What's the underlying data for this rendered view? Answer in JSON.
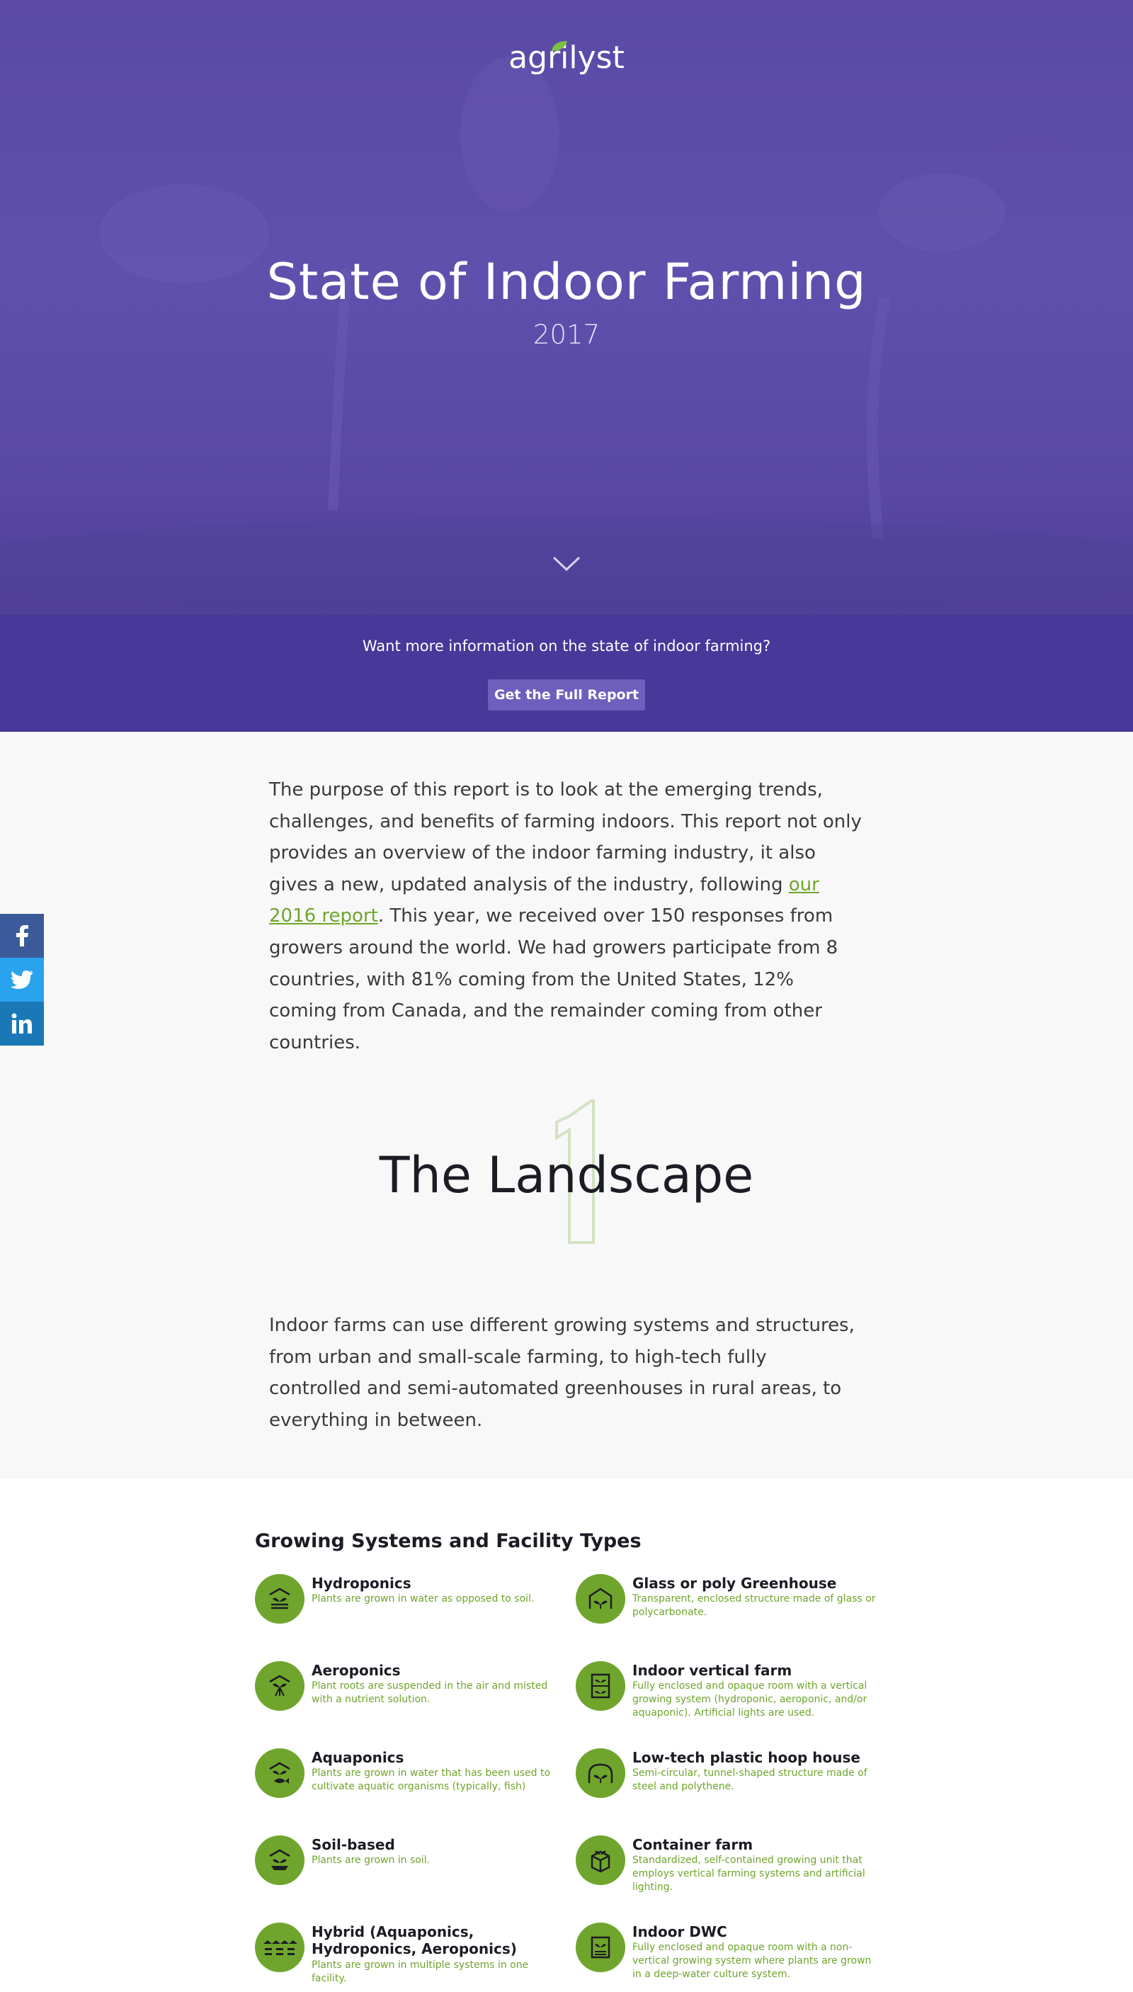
{
  "hero": {
    "logo": "agrilyst",
    "title": "State of Indoor Farming",
    "year": "2017"
  },
  "cta": {
    "text": "Want more information on the state of indoor farming?",
    "button": "Get the Full Report"
  },
  "social": [
    "facebook-icon",
    "twitter-icon",
    "linkedin-icon"
  ],
  "intro": {
    "before_link": "The purpose of this report is to look at the emerging trends, challenges, and benefits of farming indoors. This report not only provides an overview of the indoor farming industry, it also gives a new, updated analysis of the industry, following ",
    "link": "our 2016 report",
    "after_link": ". This year, we received over 150 responses from growers around the world. We had growers participate from 8 countries, with 81% coming from the United States, 12% coming from Canada, and the remainder coming from other countries."
  },
  "landscape": {
    "number": "1",
    "title": "The Landscape",
    "text": "Indoor farms can use different growing systems and structures, from urban and small-scale farming, to high-tech fully controlled and semi-automated greenhouses in rural areas, to everything in between."
  },
  "systems": {
    "title": "Growing Systems and Facility Types",
    "left": [
      {
        "name": "Hydroponics",
        "desc": "Plants are grown in water as opposed to soil.",
        "icon": "hydroponics-icon"
      },
      {
        "name": "Aeroponics",
        "desc": "Plant roots are suspended in the air and misted with a nutrient solution.",
        "icon": "aeroponics-icon"
      },
      {
        "name": "Aquaponics",
        "desc": "Plants are grown in water that has been used to cultivate aquatic organisms (typically, fish)",
        "icon": "aquaponics-icon"
      },
      {
        "name": "Soil-based",
        "desc": "Plants are grown in soil.",
        "icon": "soil-icon"
      },
      {
        "name": "Hybrid (Aquaponics, Hydroponics, Aeroponics)",
        "desc": "Plants are grown in multiple systems in one facility.",
        "icon": "hybrid-icon"
      }
    ],
    "right": [
      {
        "name": "Glass or poly Greenhouse",
        "desc": "Transparent, enclosed structure made of glass or polycarbonate.",
        "icon": "greenhouse-icon"
      },
      {
        "name": "Indoor vertical farm",
        "desc": "Fully enclosed and opaque room with a vertical growing system (hydroponic, aeroponic, and/or aquaponic). Artificial lights are used.",
        "icon": "vertical-farm-icon"
      },
      {
        "name": "Low-tech plastic hoop house",
        "desc": "Semi-circular, tunnel-shaped structure made of steel and polythene.",
        "icon": "hoop-house-icon"
      },
      {
        "name": "Container farm",
        "desc": "Standardized, self-contained growing unit that employs vertical farming systems and artificial lighting.",
        "icon": "container-icon"
      },
      {
        "name": "Indoor DWC",
        "desc": "Fully enclosed and opaque room with a non-vertical growing system where plants are grown in a deep-water culture system.",
        "icon": "dwc-icon"
      }
    ]
  }
}
